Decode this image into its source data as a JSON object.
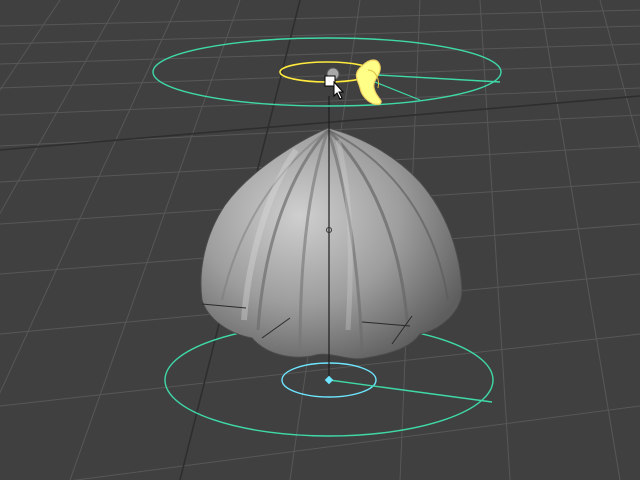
{
  "viewport": {
    "background_color": "#404040",
    "grid_color": "#5a5a5a",
    "control_color": "#3fd9a8",
    "pivot_color": "#6ee6ff",
    "handle_color": "#ffff88",
    "mesh_color": "#9a9a9a"
  },
  "scene": {
    "object_type": "deformed-sphere-mesh",
    "selection_state": "selected",
    "manipulator": "rotate-handle"
  },
  "cursor": {
    "type": "move-arrow-cursor"
  }
}
